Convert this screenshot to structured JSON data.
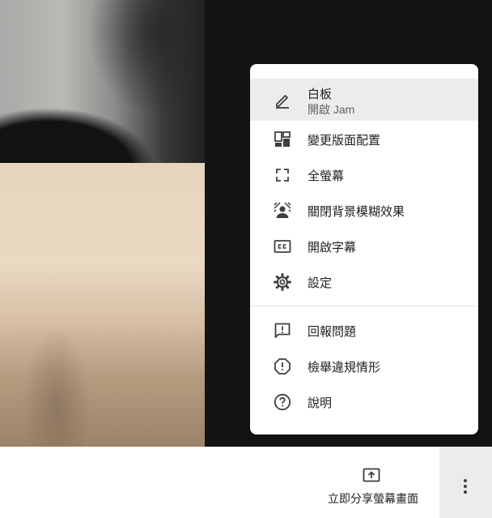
{
  "menu": {
    "items": [
      {
        "label": "白板",
        "sublabel": "開啟 Jam",
        "icon": "pen-icon"
      },
      {
        "label": "變更版面配置",
        "icon": "layout-icon"
      },
      {
        "label": "全螢幕",
        "icon": "fullscreen-icon"
      },
      {
        "label": "關閉背景模糊效果",
        "icon": "blur-background-icon"
      },
      {
        "label": "開啟字幕",
        "icon": "closed-caption-icon"
      },
      {
        "label": "設定",
        "icon": "gear-icon"
      },
      {
        "label": "回報問題",
        "icon": "feedback-icon"
      },
      {
        "label": "檢舉違規情形",
        "icon": "report-icon"
      },
      {
        "label": "說明",
        "icon": "help-icon"
      }
    ]
  },
  "bottom_bar": {
    "present_label": "立即分享螢幕畫面",
    "present_icon": "present-screen-icon",
    "more_icon": "more-vert-icon"
  },
  "colors": {
    "menu_highlight": "#ececec",
    "icon_color": "#3c4043",
    "video_background": "#141414"
  }
}
